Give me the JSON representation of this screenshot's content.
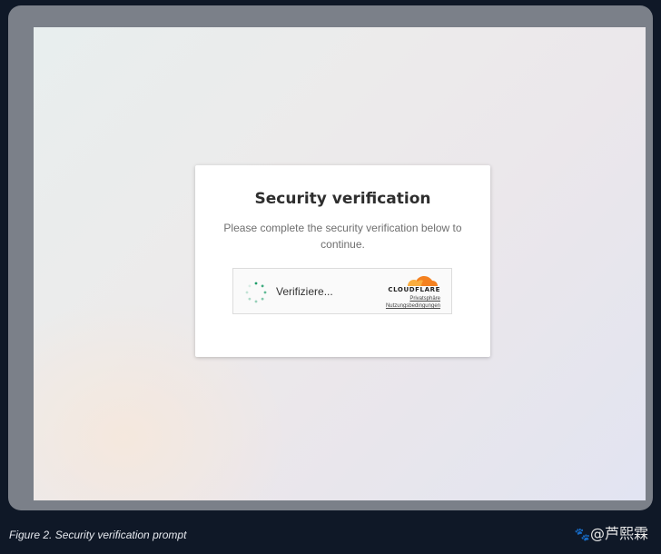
{
  "verification": {
    "title": "Security verification",
    "description": "Please complete the security verification below to continue.",
    "widget": {
      "status_label": "Verifiziere...",
      "brand": "CLOUDFLARE",
      "privacy_link": "Privatsphäre",
      "terms_link": "Nutzungsbedingungen"
    }
  },
  "figure": {
    "caption": "Figure 2. Security verification prompt"
  },
  "watermark": {
    "text": "@芦熙霖"
  },
  "colors": {
    "spinner": "#1e9e6a",
    "cloudflare_orange": "#f48120",
    "cloudflare_light": "#faad3f"
  },
  "icons": {
    "spinner": "loading-spinner-icon",
    "logo": "cloudflare-cloud-icon",
    "watermark": "paw-icon"
  }
}
